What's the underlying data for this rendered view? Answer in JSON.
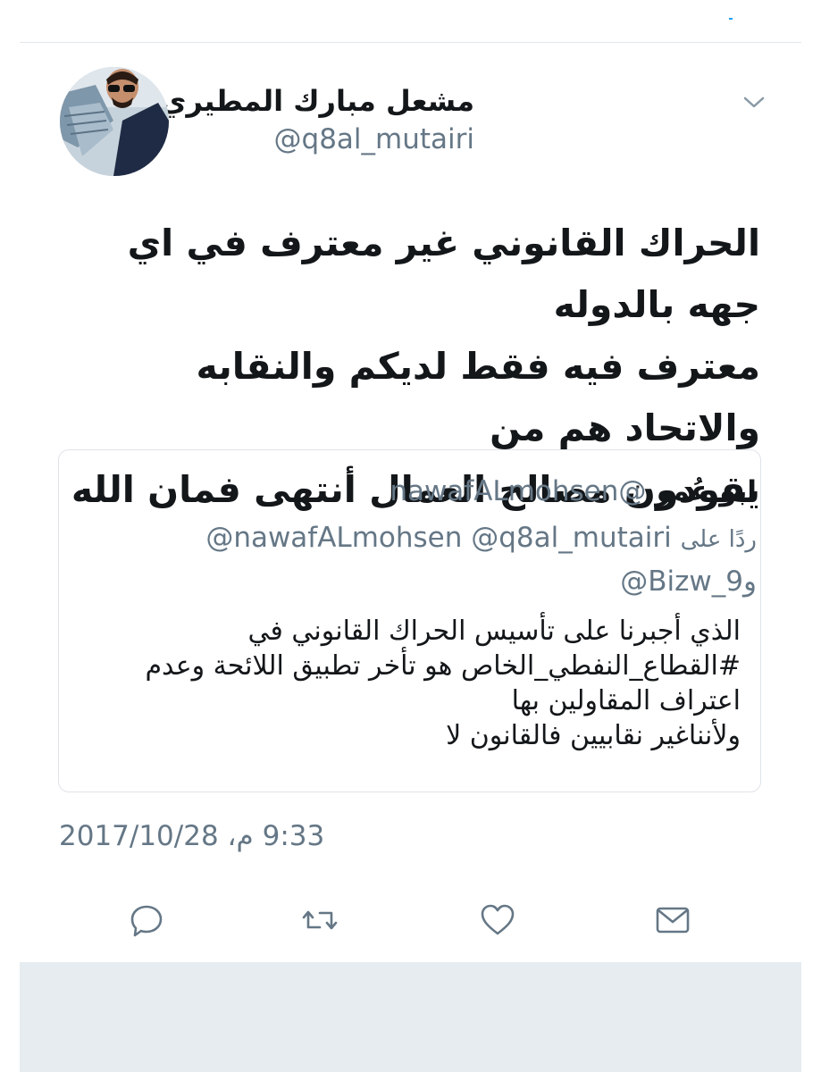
{
  "tweet": {
    "author_name": "مشعل مبارك المطيري",
    "author_handle": "@q8al_mutairi",
    "text": "الحراك القانوني غير معترف في اي جهه بالدوله\nمعترف فيه فقط لديكم والنقابه والاتحاد هم من\nيقودون مصالح العمال  أنتهى فمان الله",
    "timestamp": "9:33 م، 2017/10/28"
  },
  "quote": {
    "author_name": "ابو عُمر",
    "author_handle": "@nawafALmohsen",
    "reply_prefix": "ردًا على",
    "reply_handles": "@nawafALmohsen @q8al_mutairi",
    "reply_and": "و",
    "reply_handle_last": "@Bizw_9",
    "text": "الذي أجبرنا على تأسيس الحراك القانوني في\n#القطاع_النفطي_الخاص هو تأخر تطبيق اللائحة وعدم\nاعتراف المقاولين بها\nولأنناغير نقابيين فالقانون لا"
  },
  "icons": {
    "chevron": "chevron-down-icon",
    "reply": "reply-icon",
    "retweet": "retweet-icon",
    "like": "heart-icon",
    "dm": "envelope-icon"
  },
  "colors": {
    "text_primary": "#14171a",
    "text_secondary": "#657786",
    "divider": "#e1e8ed",
    "panel": "#e6ecf0",
    "accent": "#1da1f2"
  }
}
